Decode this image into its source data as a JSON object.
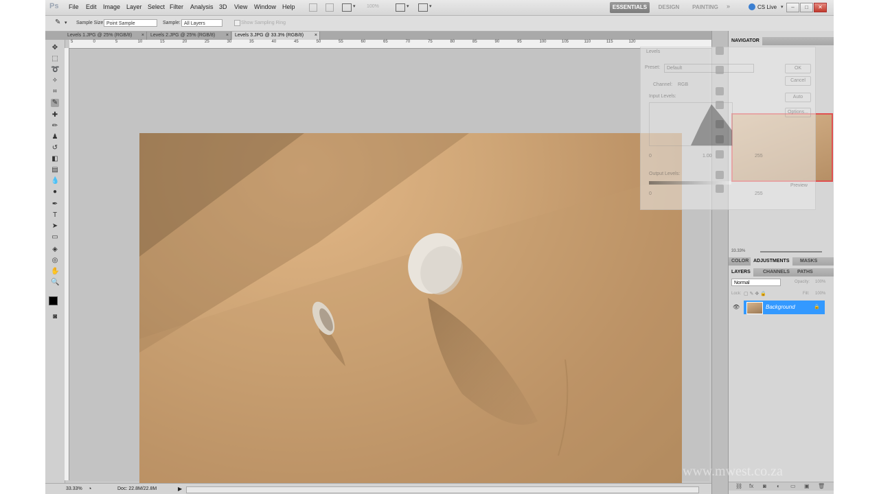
{
  "app": {
    "logo": "Ps"
  },
  "menu": [
    "File",
    "Edit",
    "Image",
    "Layer",
    "Select",
    "Filter",
    "Analysis",
    "3D",
    "View",
    "Window",
    "Help"
  ],
  "app_bar": {
    "zoom": "100%"
  },
  "workspaces": [
    "ESSENTIALS",
    "DESIGN",
    "PAINTING"
  ],
  "cs_live": "CS Live",
  "options": {
    "sample_size_label": "Sample Size:",
    "sample_size_value": "Point Sample",
    "sample_label": "Sample:",
    "sample_value": "All Layers",
    "show_ring": "Show Sampling Ring"
  },
  "tabs": [
    {
      "label": "Levels 1.JPG @ 25% (RGB/8)"
    },
    {
      "label": "Levels 2.JPG @ 25% (RGB/8)"
    },
    {
      "label": "Levels 3.JPG @ 33.3% (RGB/8)"
    }
  ],
  "ruler_h": [
    "5",
    "0",
    "5",
    "10",
    "15",
    "20",
    "25",
    "30",
    "35",
    "40",
    "45",
    "50",
    "55",
    "60",
    "65",
    "70",
    "75",
    "80",
    "85",
    "90",
    "95",
    "100",
    "105",
    "110",
    "115",
    "120"
  ],
  "status": {
    "zoom": "33.33%",
    "doc": "Doc: 22.8M/22.8M"
  },
  "levels_dialog": {
    "title": "Levels",
    "preset_label": "Preset:",
    "preset_value": "Default",
    "channel_label": "Channel:",
    "channel_value": "RGB",
    "input_levels": "Input Levels:",
    "output_levels": "Output Levels:",
    "ok": "OK",
    "cancel": "Cancel",
    "auto": "Auto",
    "options": "Options...",
    "preview": "Preview",
    "in_min": "0",
    "in_mid": "1.00",
    "in_max": "255",
    "out_min": "0",
    "out_max": "255"
  },
  "navigator": {
    "title": "NAVIGATOR",
    "zoom": "33.33%"
  },
  "adjust_tabs": [
    "COLOR",
    "ADJUSTMENTS",
    "MASKS"
  ],
  "layer_tabs": [
    "LAYERS",
    "CHANNELS",
    "PATHS"
  ],
  "layers": {
    "blend": "Normal",
    "opacity_label": "Opacity:",
    "opacity": "100%",
    "lock_label": "Lock:",
    "fill_label": "Fill:",
    "fill": "100%",
    "background": "Background"
  },
  "watermark": "www.mwest.co.za"
}
